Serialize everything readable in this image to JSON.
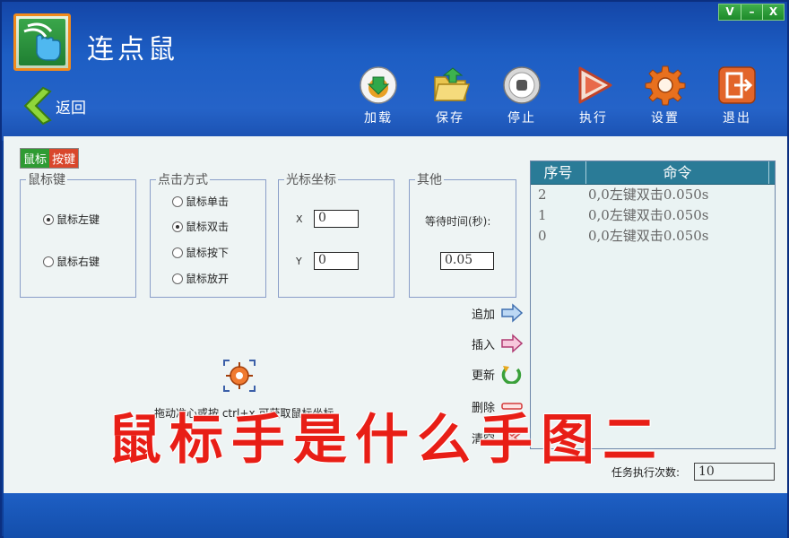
{
  "window": {
    "controls": [
      "V",
      "–",
      "X"
    ]
  },
  "app": {
    "title": "连点鼠"
  },
  "nav": {
    "back_label": "返回"
  },
  "toolbar": [
    {
      "label": "加载",
      "icon": "load-icon"
    },
    {
      "label": "保存",
      "icon": "save-folder-icon"
    },
    {
      "label": "停止",
      "icon": "stop-icon"
    },
    {
      "label": "执行",
      "icon": "play-icon"
    },
    {
      "label": "设置",
      "icon": "gear-icon"
    },
    {
      "label": "退出",
      "icon": "exit-icon"
    }
  ],
  "mode_tabs": [
    "鼠标",
    "按键"
  ],
  "mouse_key": {
    "legend": "鼠标键",
    "left": "鼠标左键",
    "right": "鼠标右键",
    "selected": "left"
  },
  "click_mode": {
    "legend": "点击方式",
    "options": [
      "鼠标单击",
      "鼠标双击",
      "鼠标按下",
      "鼠标放开"
    ],
    "selected": "鼠标双击"
  },
  "cursor": {
    "legend": "光标坐标",
    "x_label": "X",
    "x_value": "0",
    "y_label": "Y",
    "y_value": "0"
  },
  "other": {
    "legend": "其他",
    "wait_label": "等待时间(秒):",
    "wait_value": "0.05"
  },
  "target": {
    "hint": "拖动准心或按 ctrl+x 可获取鼠标坐标"
  },
  "commands": [
    {
      "label": "追加",
      "icon": "arrow-right-blue-icon"
    },
    {
      "label": "插入",
      "icon": "arrow-right-pink-icon"
    },
    {
      "label": "更新",
      "icon": "refresh-icon"
    },
    {
      "label": "删除",
      "icon": "delete-bar-icon"
    },
    {
      "label": "清空",
      "icon": "clear-x-icon"
    }
  ],
  "cmd_list": {
    "headers": [
      "序号",
      "命令"
    ],
    "rows": [
      {
        "seq": "2",
        "cmd": "0,0左键双击0.050s"
      },
      {
        "seq": "1",
        "cmd": "0,0左键双击0.050s"
      },
      {
        "seq": "0",
        "cmd": "0,0左键双击0.050s"
      }
    ]
  },
  "task": {
    "label": "任务执行次数:",
    "value": "10"
  },
  "overlay": {
    "text": "鼠标手是什么手图二"
  },
  "colors": {
    "title_bar": "#1446a8",
    "overlay": "#e81e16",
    "header": "#2a7b97",
    "tab_green": "#2f9b33",
    "tab_red": "#d9472c"
  }
}
